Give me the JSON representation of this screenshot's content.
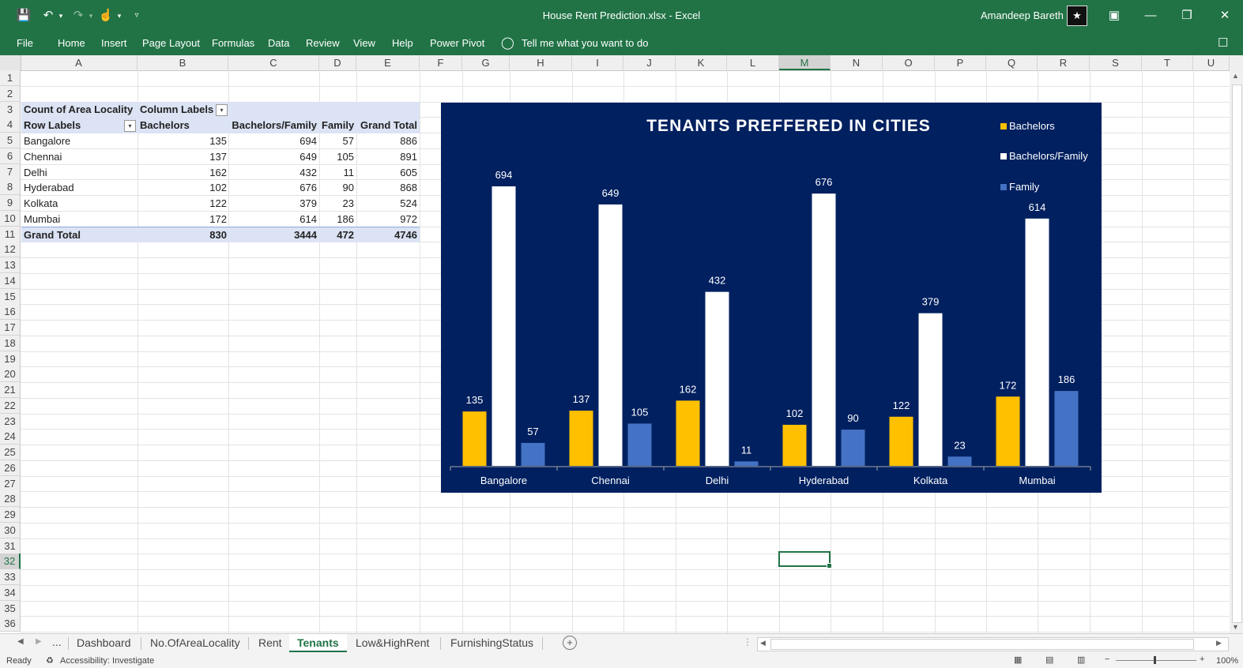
{
  "titlebar": {
    "document_title": "House Rent Prediction.xlsx  -  Excel",
    "user_name": "Amandeep Bareth",
    "icons": [
      "save-icon",
      "undo-icon",
      "redo-icon",
      "touch-mode-icon",
      "customize-qat-icon",
      "ribbon-display-icon",
      "minimize-icon",
      "restore-icon",
      "close-icon"
    ]
  },
  "ribbon": {
    "tabs": [
      "File",
      "Home",
      "Insert",
      "Page Layout",
      "Formulas",
      "Data",
      "Review",
      "View",
      "Help",
      "Power Pivot"
    ],
    "tell_me": "Tell me what you want to do"
  },
  "grid": {
    "columns": [
      "A",
      "B",
      "C",
      "D",
      "E",
      "F",
      "G",
      "H",
      "I",
      "J",
      "K",
      "L",
      "M",
      "N",
      "O",
      "P",
      "Q",
      "R",
      "S",
      "T",
      "U"
    ],
    "rows": [
      "1",
      "2",
      "3",
      "4",
      "5",
      "6",
      "7",
      "8",
      "9",
      "10",
      "11",
      "12",
      "13",
      "14",
      "15",
      "16",
      "17",
      "18",
      "19",
      "20",
      "21",
      "22",
      "23",
      "24",
      "25",
      "26",
      "27",
      "28",
      "29",
      "30",
      "31",
      "32",
      "33",
      "34",
      "35",
      "36"
    ],
    "selected_column": "M",
    "selected_row": "32"
  },
  "pivot": {
    "value_label": "Count of Area Locality",
    "column_labels": "Column Labels",
    "row_labels": "Row Labels",
    "headers": [
      "Bachelors",
      "Bachelors/Family",
      "Family",
      "Grand Total"
    ],
    "rows": [
      {
        "city": "Bangalore",
        "values": [
          "135",
          "694",
          "57",
          "886"
        ]
      },
      {
        "city": "Chennai",
        "values": [
          "137",
          "649",
          "105",
          "891"
        ]
      },
      {
        "city": "Delhi",
        "values": [
          "162",
          "432",
          "11",
          "605"
        ]
      },
      {
        "city": "Hyderabad",
        "values": [
          "102",
          "676",
          "90",
          "868"
        ]
      },
      {
        "city": "Kolkata",
        "values": [
          "122",
          "379",
          "23",
          "524"
        ]
      },
      {
        "city": "Mumbai",
        "values": [
          "172",
          "614",
          "186",
          "972"
        ]
      }
    ],
    "total_label": "Grand Total",
    "totals": [
      "830",
      "3444",
      "472",
      "4746"
    ]
  },
  "chart_data": {
    "type": "bar",
    "title": "TENANTS PREFFERED IN CITIES",
    "categories": [
      "Bangalore",
      "Chennai",
      "Delhi",
      "Hyderabad",
      "Kolkata",
      "Mumbai"
    ],
    "series": [
      {
        "name": "Bachelors",
        "values": [
          135,
          137,
          162,
          102,
          122,
          172
        ],
        "color": "#FFC000"
      },
      {
        "name": "Bachelors/Family",
        "values": [
          694,
          649,
          432,
          676,
          379,
          614
        ],
        "color": "#FFFFFF"
      },
      {
        "name": "Family",
        "values": [
          57,
          105,
          11,
          90,
          23,
          186
        ],
        "color": "#4472C4"
      }
    ],
    "ylim": [
      0,
      694
    ],
    "grid": false,
    "legend": "top-right",
    "background": "#002060"
  },
  "sheets": {
    "tabs": [
      "Dashboard",
      "No.OfAreaLocality",
      "Rent",
      "Tenants",
      "Low&HighRent",
      "FurnishingStatus"
    ],
    "active": "Tenants",
    "more": "...",
    "add_icon": "plus-circle-icon"
  },
  "status": {
    "ready": "Ready",
    "accessibility": "Accessibility: Investigate",
    "zoom": "100%"
  },
  "colors": {
    "excel_green": "#217346",
    "pivot_header": "#DBE3F4"
  }
}
